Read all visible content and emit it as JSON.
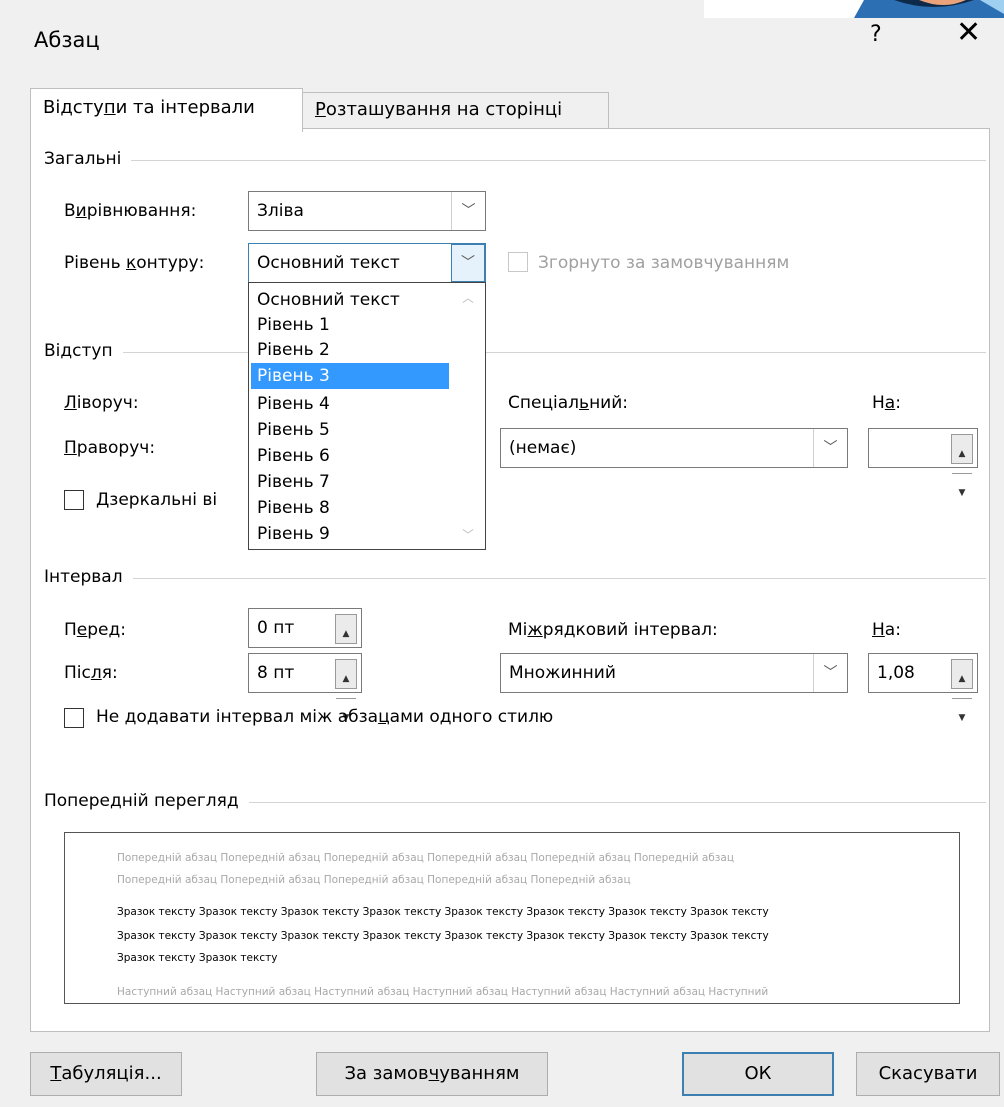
{
  "dialog": {
    "title": "Абзац",
    "help": "?",
    "close": "✕"
  },
  "tabs": [
    {
      "pre": "Відсту",
      "ul": "п",
      "post": "и та інтервали",
      "active": true
    },
    {
      "pre": "",
      "ul": "Р",
      "post": "озташування на сторінці",
      "active": false
    }
  ],
  "general": {
    "section": "Загальні",
    "alignment_label": {
      "pre": "В",
      "ul": "и",
      "post": "рівнювання:"
    },
    "alignment_value": "Зліва",
    "outline_label": {
      "pre": "Рівень ",
      "ul": "к",
      "post": "онтуру:"
    },
    "outline_value": "Основний текст",
    "collapsed_label": "Згорнуто за замовчуванням",
    "outline_options": [
      "Основний текст",
      "Рівень 1",
      "Рівень 2",
      "Рівень 3",
      "Рівень 4",
      "Рівень 5",
      "Рівень 6",
      "Рівень 7",
      "Рівень 8",
      "Рівень 9"
    ],
    "outline_selected_index": 3
  },
  "indent": {
    "section": "Відступ",
    "left_label": {
      "pre": "",
      "ul": "Л",
      "post": "іворуч:"
    },
    "right_label": {
      "pre": "",
      "ul": "П",
      "post": "раворуч:"
    },
    "mirror_label": {
      "pre": "",
      "ul": "Д",
      "post": "зеркальні ві"
    },
    "special_label": {
      "pre": "Спеціал",
      "ul": "ь",
      "post": "ний:"
    },
    "special_value": "(немає)",
    "by_label": {
      "pre": "Н",
      "ul": "а",
      "post": ":"
    },
    "by_value": ""
  },
  "spacing": {
    "section": "Інтервал",
    "before_label": {
      "pre": "П",
      "ul": "е",
      "post": "ред:"
    },
    "before_value": "0 пт",
    "after_label": {
      "pre": "Піс",
      "ul": "л",
      "post": "я:"
    },
    "after_value": "8 пт",
    "line_label": {
      "pre": "Мі",
      "ul": "ж",
      "post": "рядковий інтервал:"
    },
    "line_value": "Множинний",
    "at_label": {
      "pre": "",
      "ul": "Н",
      "post": "а:"
    },
    "at_value": "1,08",
    "no_space_label": {
      "pre": "Не додавати інтервал між абза",
      "ul": "ц",
      "post": "ами одного стилю"
    }
  },
  "preview": {
    "section": "Попередній перегляд",
    "prev_line1": "Попередній абзац Попередній абзац Попередній абзац Попередній абзац Попередній абзац Попередній абзац",
    "prev_line2": "Попередній абзац Попередній абзац Попередній абзац Попередній абзац Попередній абзац",
    "sample_line1": "Зразок тексту Зразок тексту Зразок тексту Зразок тексту Зразок тексту Зразок тексту Зразок тексту Зразок тексту",
    "sample_line2": "Зразок тексту Зразок тексту Зразок тексту Зразок тексту Зразок тексту Зразок тексту Зразок тексту Зразок тексту",
    "sample_line3": "Зразок тексту Зразок тексту",
    "next_line1": "Наступний абзац Наступний абзац Наступний абзац Наступний абзац Наступний абзац Наступний абзац Наступний"
  },
  "buttons": {
    "tabs": {
      "pre": "",
      "ul": "Т",
      "post": "абуляція..."
    },
    "default": {
      "pre": "За замов",
      "ul": "ч",
      "post": "уванням"
    },
    "ok": "ОК",
    "cancel": "Скасувати"
  }
}
